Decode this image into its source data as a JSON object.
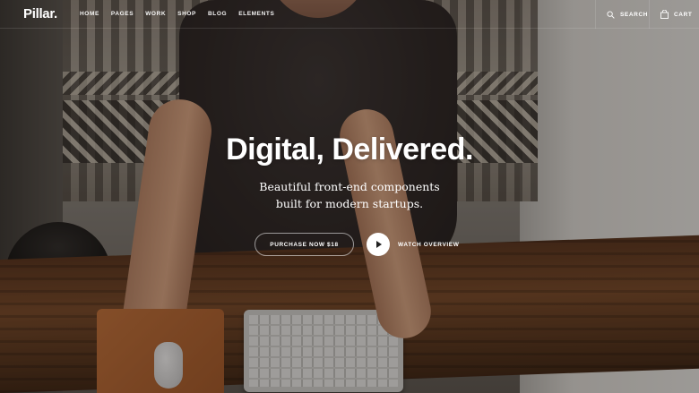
{
  "brand": {
    "logo": "Pillar."
  },
  "nav": {
    "items": [
      {
        "label": "HOME"
      },
      {
        "label": "PAGES"
      },
      {
        "label": "WORK"
      },
      {
        "label": "SHOP"
      },
      {
        "label": "BLOG"
      },
      {
        "label": "ELEMENTS"
      }
    ],
    "search_label": "SEARCH",
    "search_icon": "search-icon",
    "cart_label": "CART",
    "cart_icon": "bag-icon"
  },
  "hero": {
    "title": "Digital, Delivered.",
    "subtitle_line1": "Beautiful front-end components",
    "subtitle_line2": "built for modern startups.",
    "purchase_label": "PURCHASE NOW $18",
    "video_label": "WATCH OVERVIEW",
    "play_icon": "play-icon"
  },
  "colors": {
    "text": "#ffffff",
    "overlay": "#141010",
    "play_button": "#ffffff"
  }
}
